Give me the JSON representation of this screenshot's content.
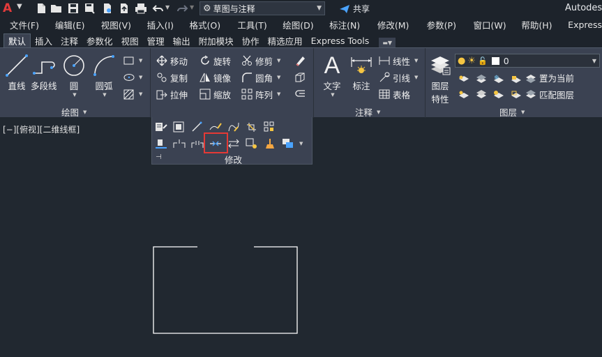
{
  "titlebar": {
    "logo_text": "A",
    "workspace": "草图与注释",
    "share_label": "共享",
    "app_title": "Autodesk AutoCAD"
  },
  "menubar": {
    "items": [
      "文件(F)",
      "编辑(E)",
      "视图(V)",
      "插入(I)",
      "格式(O)",
      "工具(T)",
      "绘图(D)",
      "标注(N)",
      "修改(M)",
      "参数(P)",
      "窗口(W)",
      "帮助(H)",
      "Express"
    ]
  },
  "tabs": {
    "items": [
      "默认",
      "插入",
      "注释",
      "参数化",
      "视图",
      "管理",
      "输出",
      "附加模块",
      "协作",
      "精选应用",
      "Express Tools"
    ],
    "active": "默认"
  },
  "ribbon": {
    "draw": {
      "title": "绘图",
      "line": "直线",
      "polyline": "多段线",
      "circle": "圆",
      "arc": "圆弧"
    },
    "modify": {
      "title": "修改",
      "move": "移动",
      "rotate": "旋转",
      "trim": "修剪",
      "copy": "复制",
      "mirror": "镜像",
      "fillet": "圆角",
      "stretch": "拉伸",
      "scale": "缩放",
      "array": "阵列"
    },
    "annotation": {
      "title": "注释",
      "text": "文字",
      "dimension": "标注",
      "linear": "线性",
      "leader": "引线",
      "table": "表格"
    },
    "layers": {
      "title": "图层",
      "properties_line1": "图层",
      "properties_line2": "特性",
      "current_layer": "0",
      "set_current": "置为当前",
      "match_layer": "匹配图层"
    }
  },
  "viewport": {
    "label": "[−][俯视][二维线框]"
  },
  "colors": {
    "background": "#212830",
    "ribbon": "#3b4252",
    "accent_red": "#e53935",
    "logo_red": "#e23b3b",
    "share_blue": "#4aa3ff"
  }
}
